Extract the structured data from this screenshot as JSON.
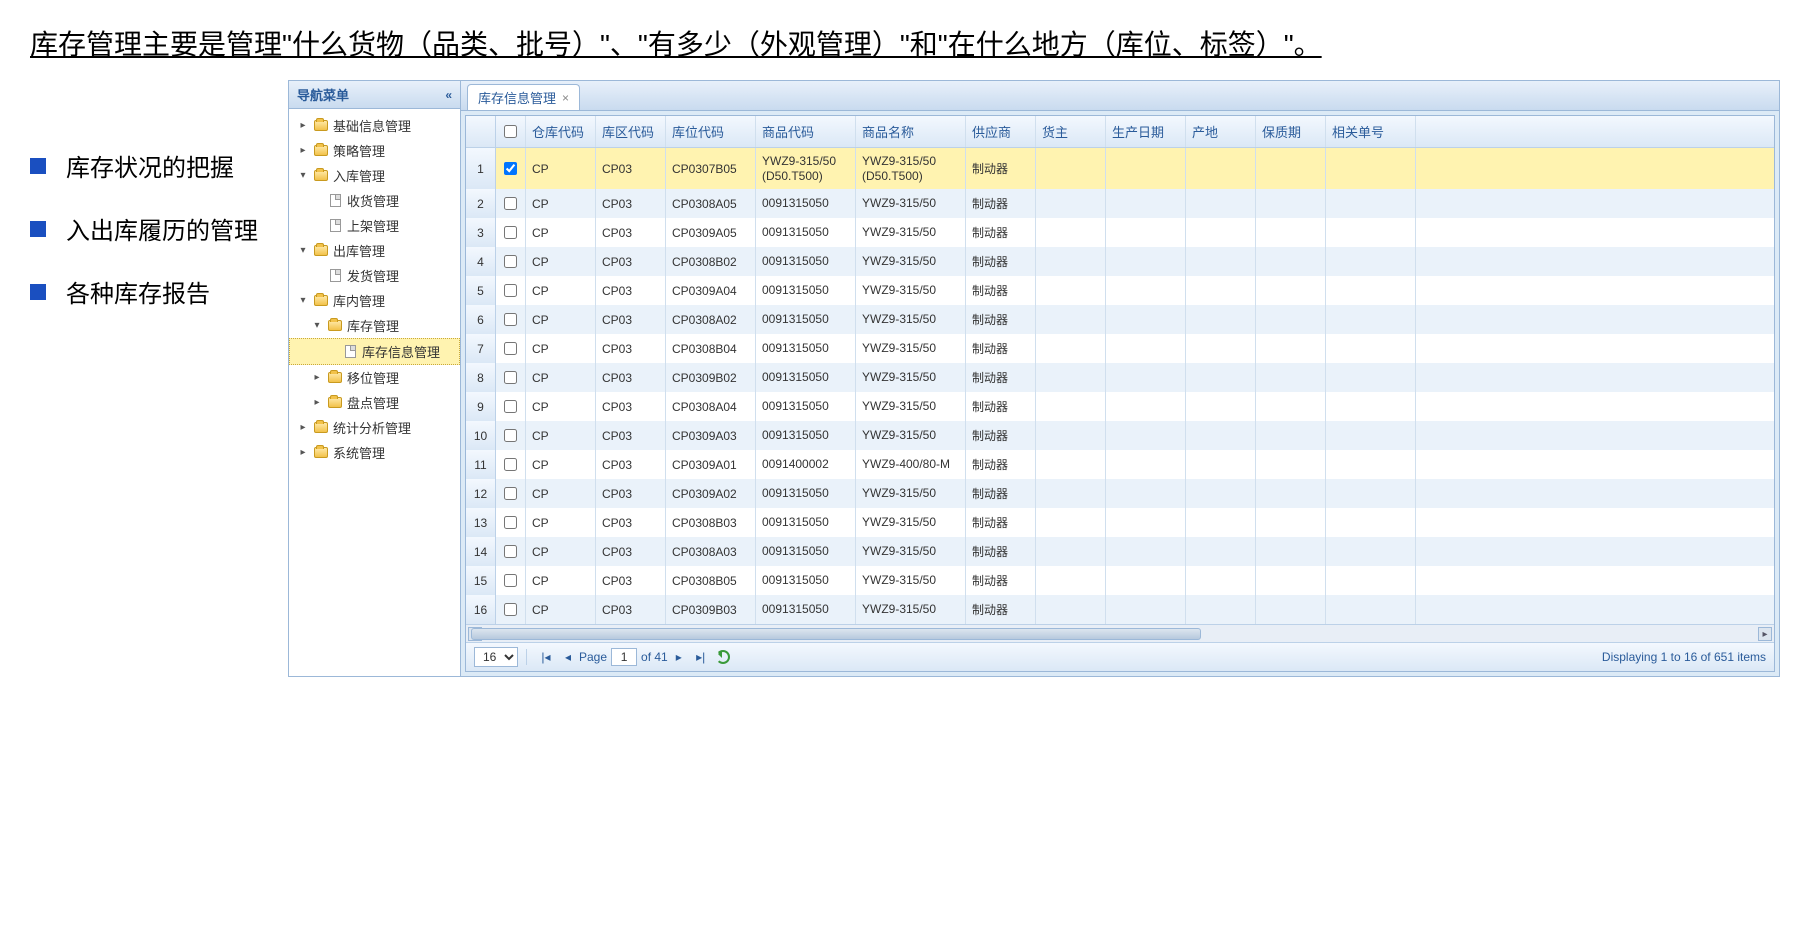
{
  "heading": "库存管理主要是管理\"什么货物（品类、批号）\"、\"有多少（外观管理）\"和\"在什么地方（库位、标签）\"。",
  "bullets": [
    "库存状况的把握",
    "入出库履历的管理",
    "各种库存报告"
  ],
  "nav": {
    "title": "导航菜单",
    "items": [
      {
        "label": "基础信息管理",
        "depth": 1,
        "exp": "▸",
        "ico": "folder-closed"
      },
      {
        "label": "策略管理",
        "depth": 1,
        "exp": "▸",
        "ico": "folder-closed"
      },
      {
        "label": "入库管理",
        "depth": 1,
        "exp": "▾",
        "ico": "folder-open"
      },
      {
        "label": "收货管理",
        "depth": 2,
        "exp": "",
        "ico": "page"
      },
      {
        "label": "上架管理",
        "depth": 2,
        "exp": "",
        "ico": "page"
      },
      {
        "label": "出库管理",
        "depth": 1,
        "exp": "▾",
        "ico": "folder-open"
      },
      {
        "label": "发货管理",
        "depth": 2,
        "exp": "",
        "ico": "page"
      },
      {
        "label": "库内管理",
        "depth": 1,
        "exp": "▾",
        "ico": "folder-open"
      },
      {
        "label": "库存管理",
        "depth": 2,
        "exp": "▾",
        "ico": "folder-open"
      },
      {
        "label": "库存信息管理",
        "depth": 3,
        "exp": "",
        "ico": "page",
        "selected": true
      },
      {
        "label": "移位管理",
        "depth": 2,
        "exp": "▸",
        "ico": "folder-closed"
      },
      {
        "label": "盘点管理",
        "depth": 2,
        "exp": "▸",
        "ico": "folder-closed"
      },
      {
        "label": "统计分析管理",
        "depth": 1,
        "exp": "▸",
        "ico": "folder-closed"
      },
      {
        "label": "系统管理",
        "depth": 1,
        "exp": "▸",
        "ico": "folder-closed"
      }
    ]
  },
  "tab": {
    "label": "库存信息管理"
  },
  "columns": [
    "仓库代码",
    "库区代码",
    "库位代码",
    "商品代码",
    "商品名称",
    "供应商",
    "货主",
    "生产日期",
    "产地",
    "保质期",
    "相关单号"
  ],
  "rows": [
    {
      "num": 1,
      "chk": true,
      "a": "CP",
      "b": "CP03",
      "c": "CP0307B05",
      "d": "YWZ9-315/50 (D50.T500)",
      "e": "YWZ9-315/50 (D50.T500)",
      "f": "制动器",
      "selected": true
    },
    {
      "num": 2,
      "chk": false,
      "a": "CP",
      "b": "CP03",
      "c": "CP0308A05",
      "d": "0091315050",
      "e": "YWZ9-315/50",
      "f": "制动器"
    },
    {
      "num": 3,
      "chk": false,
      "a": "CP",
      "b": "CP03",
      "c": "CP0309A05",
      "d": "0091315050",
      "e": "YWZ9-315/50",
      "f": "制动器"
    },
    {
      "num": 4,
      "chk": false,
      "a": "CP",
      "b": "CP03",
      "c": "CP0308B02",
      "d": "0091315050",
      "e": "YWZ9-315/50",
      "f": "制动器"
    },
    {
      "num": 5,
      "chk": false,
      "a": "CP",
      "b": "CP03",
      "c": "CP0309A04",
      "d": "0091315050",
      "e": "YWZ9-315/50",
      "f": "制动器"
    },
    {
      "num": 6,
      "chk": false,
      "a": "CP",
      "b": "CP03",
      "c": "CP0308A02",
      "d": "0091315050",
      "e": "YWZ9-315/50",
      "f": "制动器"
    },
    {
      "num": 7,
      "chk": false,
      "a": "CP",
      "b": "CP03",
      "c": "CP0308B04",
      "d": "0091315050",
      "e": "YWZ9-315/50",
      "f": "制动器"
    },
    {
      "num": 8,
      "chk": false,
      "a": "CP",
      "b": "CP03",
      "c": "CP0309B02",
      "d": "0091315050",
      "e": "YWZ9-315/50",
      "f": "制动器"
    },
    {
      "num": 9,
      "chk": false,
      "a": "CP",
      "b": "CP03",
      "c": "CP0308A04",
      "d": "0091315050",
      "e": "YWZ9-315/50",
      "f": "制动器"
    },
    {
      "num": 10,
      "chk": false,
      "a": "CP",
      "b": "CP03",
      "c": "CP0309A03",
      "d": "0091315050",
      "e": "YWZ9-315/50",
      "f": "制动器"
    },
    {
      "num": 11,
      "chk": false,
      "a": "CP",
      "b": "CP03",
      "c": "CP0309A01",
      "d": "0091400002",
      "e": "YWZ9-400/80-M",
      "f": "制动器"
    },
    {
      "num": 12,
      "chk": false,
      "a": "CP",
      "b": "CP03",
      "c": "CP0309A02",
      "d": "0091315050",
      "e": "YWZ9-315/50",
      "f": "制动器"
    },
    {
      "num": 13,
      "chk": false,
      "a": "CP",
      "b": "CP03",
      "c": "CP0308B03",
      "d": "0091315050",
      "e": "YWZ9-315/50",
      "f": "制动器"
    },
    {
      "num": 14,
      "chk": false,
      "a": "CP",
      "b": "CP03",
      "c": "CP0308A03",
      "d": "0091315050",
      "e": "YWZ9-315/50",
      "f": "制动器"
    },
    {
      "num": 15,
      "chk": false,
      "a": "CP",
      "b": "CP03",
      "c": "CP0308B05",
      "d": "0091315050",
      "e": "YWZ9-315/50",
      "f": "制动器"
    },
    {
      "num": 16,
      "chk": false,
      "a": "CP",
      "b": "CP03",
      "c": "CP0309B03",
      "d": "0091315050",
      "e": "YWZ9-315/50",
      "f": "制动器"
    }
  ],
  "pager": {
    "pageSize": "16",
    "pageLabel": "Page",
    "page": "1",
    "ofLabel": "of 41",
    "status": "Displaying 1 to 16 of 651 items"
  }
}
